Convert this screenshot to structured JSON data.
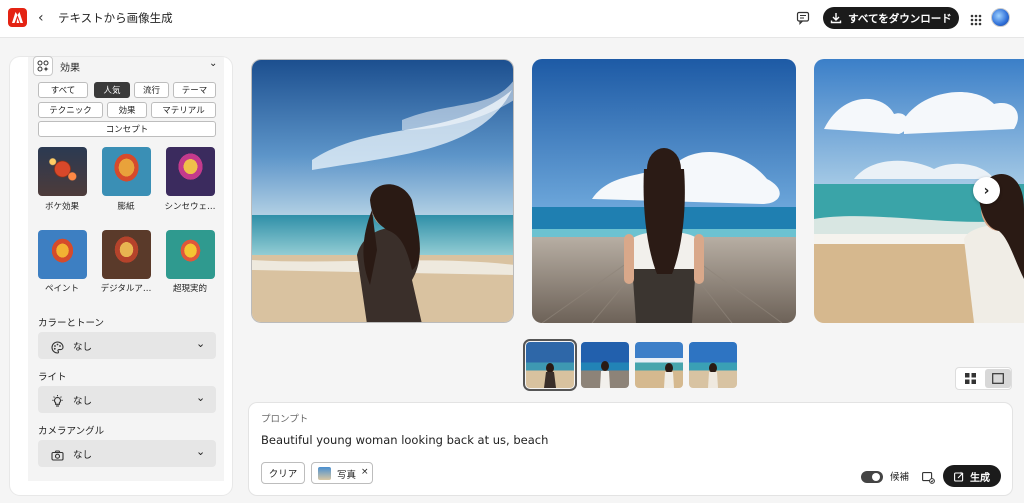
{
  "header": {
    "title": "テキストから画像生成",
    "download_label": "すべてをダウンロード",
    "icons": [
      "adobe-logo",
      "back-chevron",
      "feedback-icon",
      "download-icon",
      "apps-grid-icon",
      "avatar"
    ]
  },
  "effects": {
    "title": "効果",
    "filters": [
      {
        "label": "すべて",
        "active": false
      },
      {
        "label": "人気",
        "active": true
      },
      {
        "label": "流行",
        "active": false
      },
      {
        "label": "テーマ",
        "active": false
      },
      {
        "label": "テクニック",
        "active": false
      },
      {
        "label": "効果",
        "active": false
      },
      {
        "label": "マテリアル",
        "active": false
      },
      {
        "label": "コンセプト",
        "active": false
      }
    ],
    "styles": [
      {
        "label": "ボケ効果"
      },
      {
        "label": "膨紙"
      },
      {
        "label": "シンセウェ…"
      },
      {
        "label": "ペイント"
      },
      {
        "label": "デジタルア…"
      },
      {
        "label": "超現実的"
      }
    ]
  },
  "color_tone": {
    "label": "カラーとトーン",
    "value": "なし"
  },
  "light": {
    "label": "ライト",
    "value": "なし"
  },
  "camera": {
    "label": "カメラアングル",
    "value": "なし"
  },
  "prompt": {
    "label": "プロンプト",
    "text": "Beautiful young woman looking back at us, beach",
    "clear_label": "クリア",
    "reference_label": "写真",
    "reference_close": "×",
    "candidates_label": "候補",
    "generate_label": "生成"
  },
  "gallery": {
    "selected_index": 0,
    "count": 4
  },
  "colors": {
    "accent": "#e42313",
    "dark_button": "#1b1b1b"
  }
}
